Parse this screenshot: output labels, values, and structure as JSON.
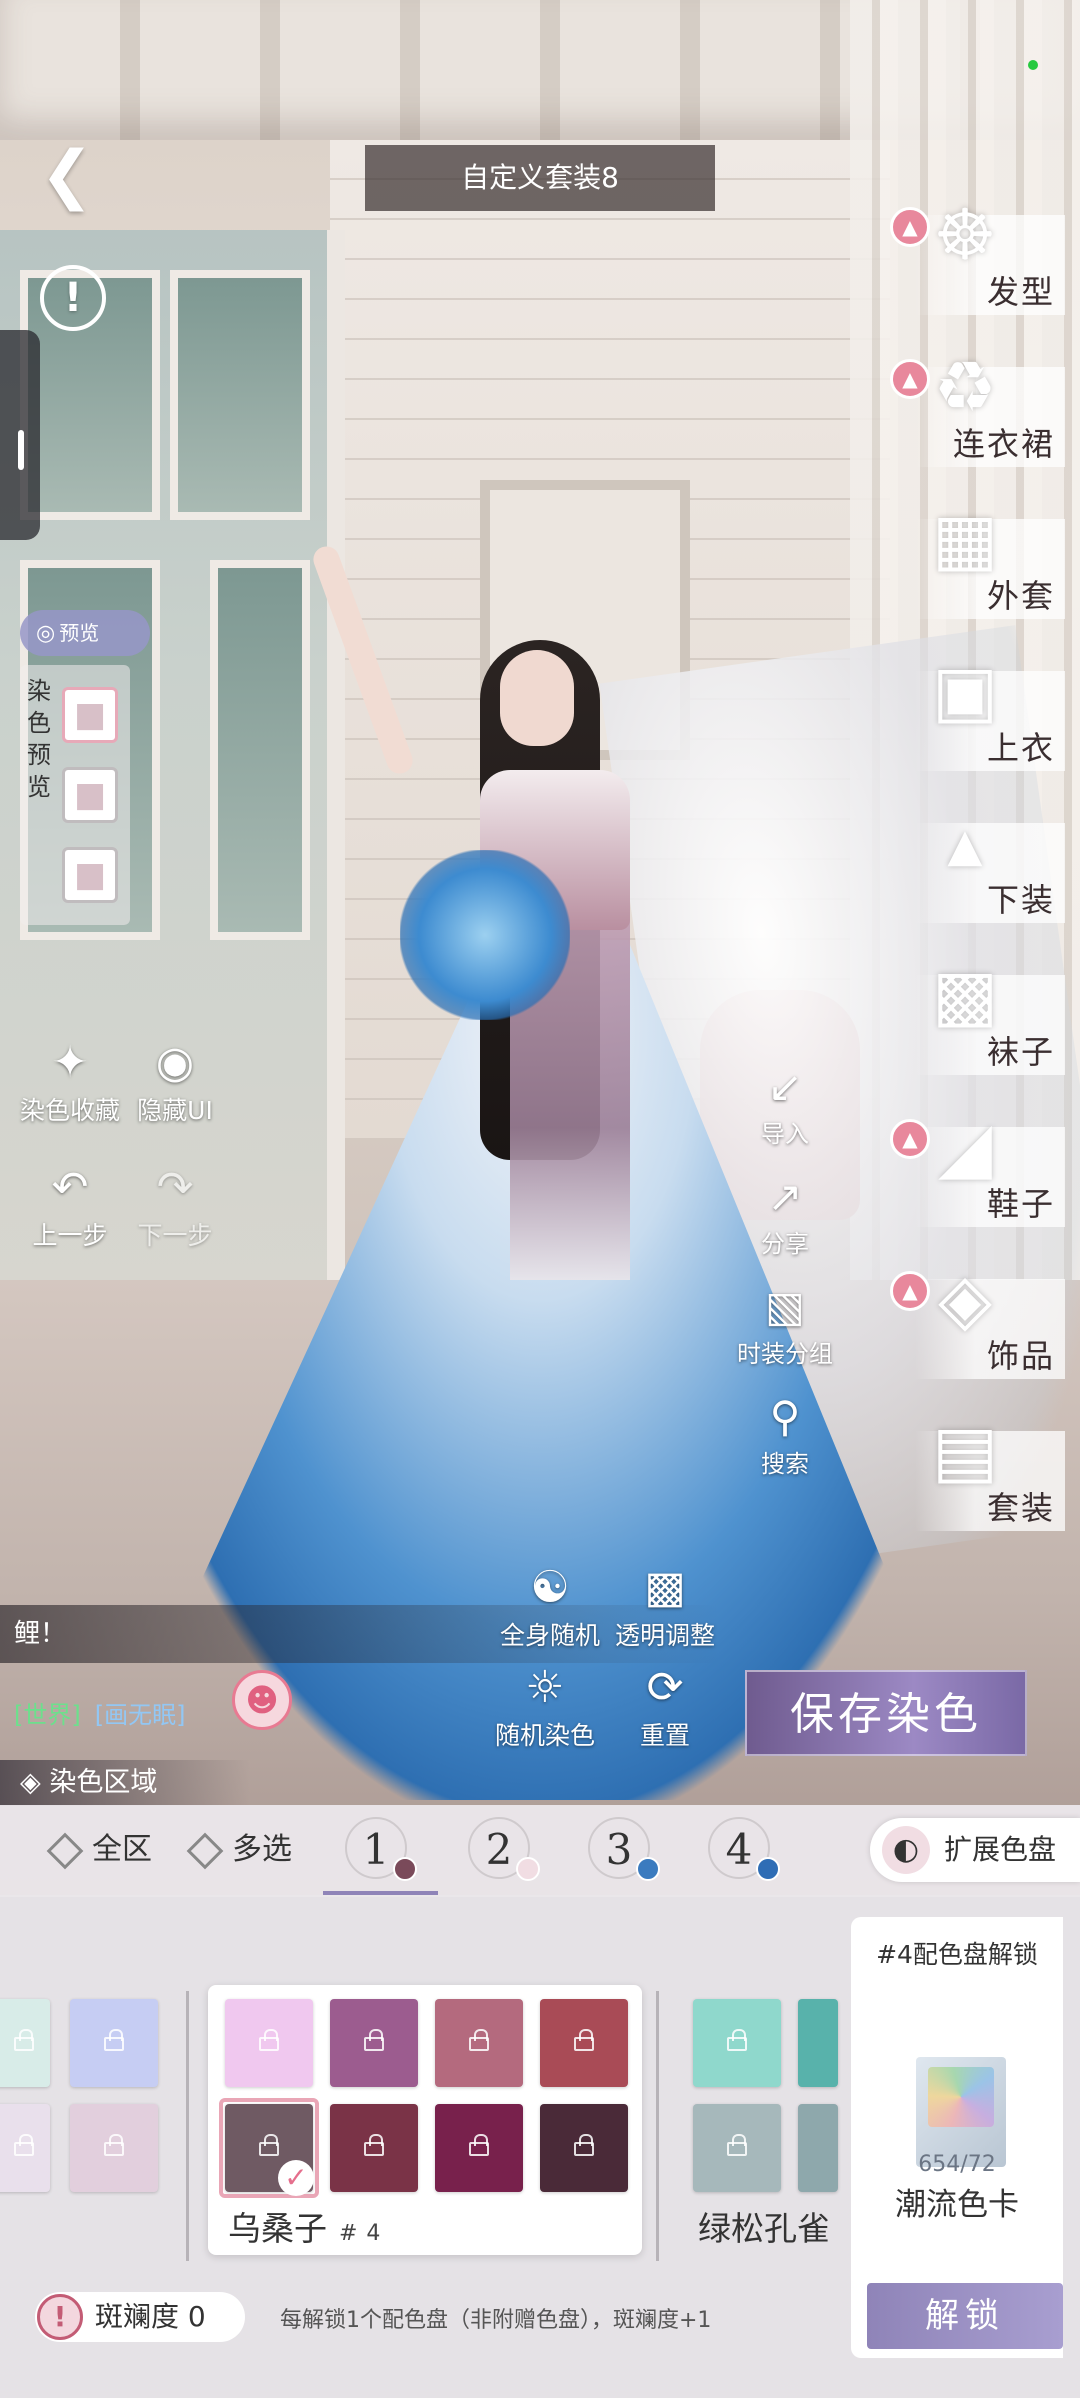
{
  "header": {
    "title": "自定义套装8"
  },
  "left_tools": {
    "preview_toggle": "预览",
    "preview_label": "染色预览",
    "favorites": "染色收藏",
    "hide_ui": "隐藏UI",
    "undo": "上一步",
    "redo": "下一步"
  },
  "right_tools": {
    "import": "导入",
    "share": "分享",
    "group": "时装分组",
    "search": "搜索"
  },
  "categories": [
    {
      "label": "发型",
      "icon": "hair-icon",
      "badge": true
    },
    {
      "label": "连衣裙",
      "icon": "dress-icon",
      "badge": true
    },
    {
      "label": "外套",
      "icon": "coat-icon",
      "badge": false
    },
    {
      "label": "上衣",
      "icon": "top-icon",
      "badge": false
    },
    {
      "label": "下装",
      "icon": "skirt-icon",
      "badge": false
    },
    {
      "label": "袜子",
      "icon": "socks-icon",
      "badge": false
    },
    {
      "label": "鞋子",
      "icon": "shoes-icon",
      "badge": true
    },
    {
      "label": "饰品",
      "icon": "accessory-icon",
      "badge": true
    },
    {
      "label": "套装",
      "icon": "outfit-icon",
      "badge": false
    }
  ],
  "bottom_tools": {
    "random_all": "全身随机",
    "transparency": "透明调整",
    "random_dye": "随机染色",
    "reset": "重置"
  },
  "chat": {
    "message": "鲤！",
    "world_tag": "[世界]",
    "channel_tag": "[画无眠]"
  },
  "save_button": "保存染色",
  "dye_area_label": "染色区域",
  "selector": {
    "all": "全区",
    "multi": "多选",
    "regions": [
      {
        "num": "1",
        "color": "#7a4a5a"
      },
      {
        "num": "2",
        "color": "#f1dde3"
      },
      {
        "num": "3",
        "color": "#3b7bbf"
      },
      {
        "num": "4",
        "color": "#2f6db5"
      }
    ],
    "expand": "扩展色盘"
  },
  "palette": {
    "left_group_colors": [
      "#d8ece8",
      "#c6cdf3",
      "#e9e0ec",
      "#e2cfdd"
    ],
    "main_group": {
      "name": "乌桑子",
      "tag": "# 4",
      "colors": [
        "#f0c8ef",
        "#9c5c8f",
        "#b46a7e",
        "#a94b56",
        "#6f5a63",
        "#7a3347",
        "#78214c",
        "#4a2a38"
      ],
      "selected_index": 4
    },
    "right_group": {
      "name": "绿松孔雀",
      "colors": [
        "#8fd8cc",
        "#58b2ab",
        "#a6b8bb",
        "#8ea8ac"
      ]
    }
  },
  "unlock_card": {
    "title": "#4配色盘解锁",
    "count": "654/72",
    "name": "潮流色卡",
    "button": "解锁"
  },
  "spot": {
    "label": "斑斓度",
    "value": "0",
    "hint": "每解锁1个配色盘（非附赠色盘），斑斓度+1"
  }
}
